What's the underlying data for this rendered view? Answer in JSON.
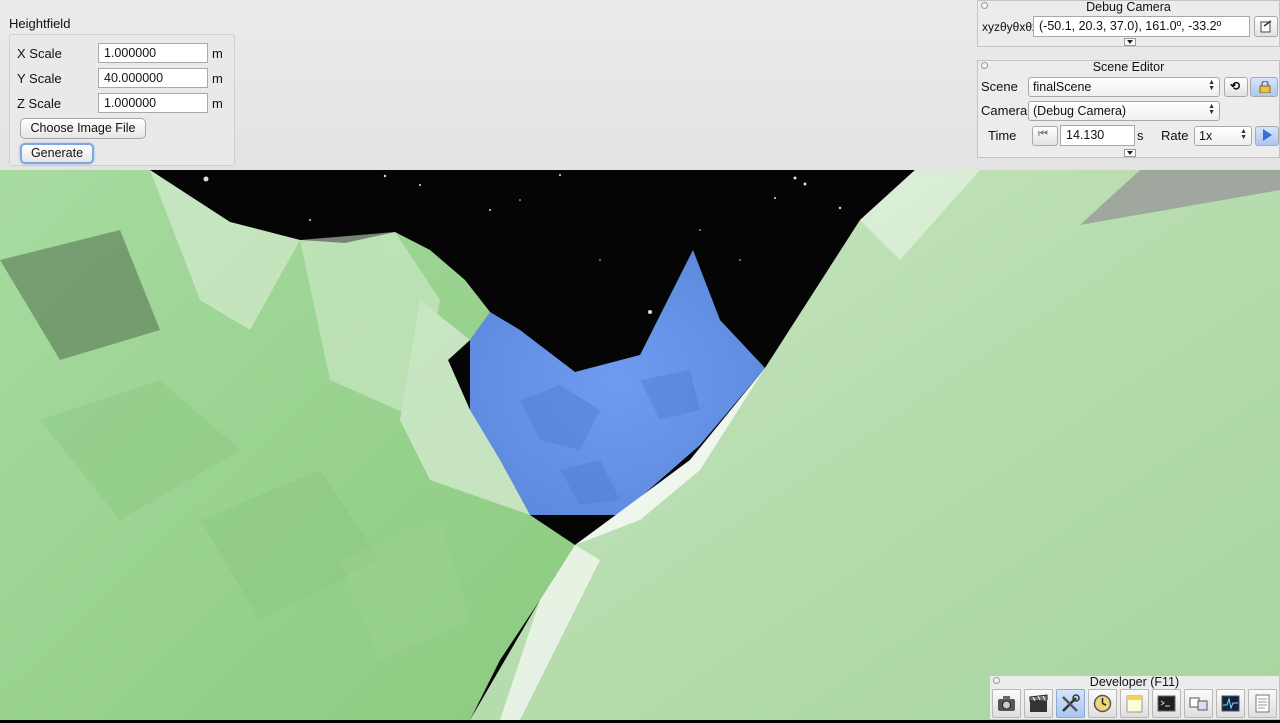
{
  "heightfield": {
    "title": "Heightfield",
    "rows": [
      {
        "label": "X Scale",
        "value": "1.000000",
        "unit": "m"
      },
      {
        "label": "Y Scale",
        "value": "40.000000",
        "unit": "m"
      },
      {
        "label": "Z Scale",
        "value": "1.000000",
        "unit": "m"
      }
    ],
    "choose_label": "Choose Image File",
    "generate_label": "Generate"
  },
  "debug_camera": {
    "title": "Debug Camera",
    "axis_label": "xyzθyθxθz",
    "value": "(-50.1,  20.3,  37.0),  161.0º, -33.2º"
  },
  "scene_editor": {
    "title": "Scene Editor",
    "scene_label": "Scene",
    "scene_value": "finalScene",
    "camera_label": "Camera",
    "camera_value": "(Debug Camera)",
    "time_label": "Time",
    "time_value": "14.130",
    "time_unit": "s",
    "rate_label": "Rate",
    "rate_value": "1x"
  },
  "developer": {
    "title": "Developer (F11)",
    "icons": [
      "camera-icon",
      "film-clapper-icon",
      "tools-icon",
      "clock-icon",
      "notes-icon",
      "terminal-icon",
      "windows-icon",
      "performance-monitor-icon",
      "document-icon"
    ],
    "active_icon": "tools-icon"
  },
  "colors": {
    "terrain_green": "#9ed594",
    "water_blue": "#6f9cf0",
    "sky_black": "#050506",
    "panel_bg": "#ececec",
    "accent_blue": "#7fa6e0"
  }
}
